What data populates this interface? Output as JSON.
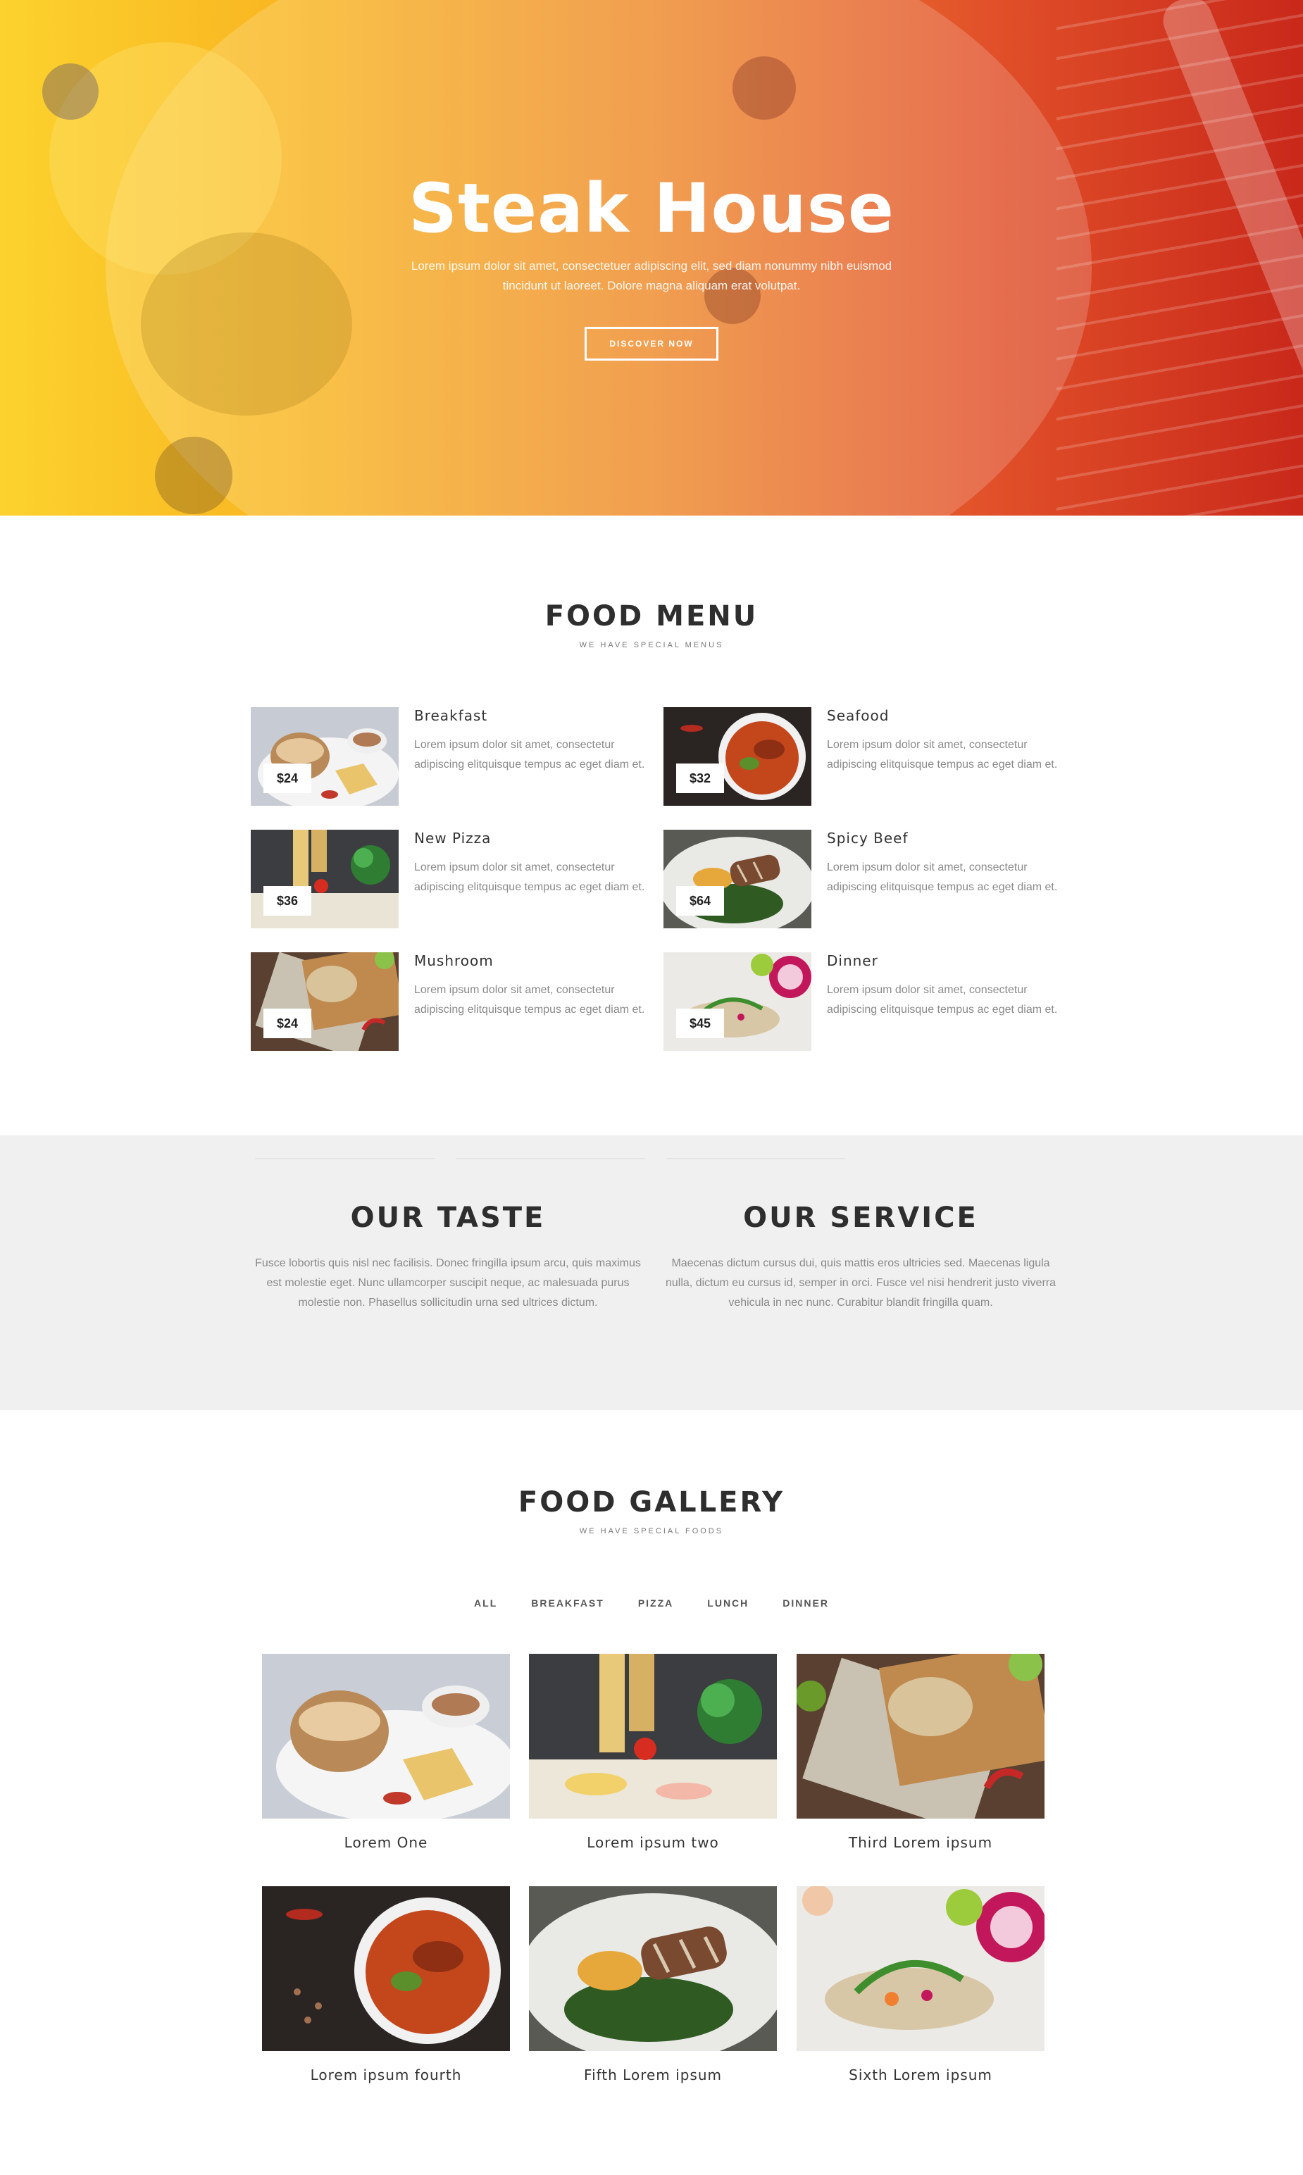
{
  "hero": {
    "title": "Steak House",
    "subtitle": "Lorem ipsum dolor sit amet, consectetuer adipiscing elit, sed diam nonummy nibh euismod tincidunt ut laoreet. Dolore magna aliquam erat volutpat.",
    "button_label": "DISCOVER NOW",
    "gradient": [
      "#fcd22e",
      "#ee8a2a",
      "#c9281a"
    ]
  },
  "menu": {
    "title": "FOOD MENU",
    "subtitle": "WE HAVE SPECIAL MENUS",
    "items": [
      {
        "name": "Breakfast",
        "price": "$24",
        "desc": "Lorem ipsum dolor sit amet, consectetur adipiscing elitquisque tempus ac eget diam et."
      },
      {
        "name": "Seafood",
        "price": "$32",
        "desc": "Lorem ipsum dolor sit amet, consectetur adipiscing elitquisque tempus ac eget diam et."
      },
      {
        "name": "New Pizza",
        "price": "$36",
        "desc": "Lorem ipsum dolor sit amet, consectetur adipiscing elitquisque tempus ac eget diam et."
      },
      {
        "name": "Spicy Beef",
        "price": "$64",
        "desc": "Lorem ipsum dolor sit amet, consectetur adipiscing elitquisque tempus ac eget diam et."
      },
      {
        "name": "Mushroom",
        "price": "$24",
        "desc": "Lorem ipsum dolor sit amet, consectetur adipiscing elitquisque tempus ac eget diam et."
      },
      {
        "name": "Dinner",
        "price": "$45",
        "desc": "Lorem ipsum dolor sit amet, consectetur adipiscing elitquisque tempus ac eget diam et."
      }
    ]
  },
  "about": {
    "taste_title": "OUR TASTE",
    "taste_text": "Fusce lobortis quis nisl nec facilisis. Donec fringilla ipsum arcu, quis maximus est molestie eget. Nunc ullamcorper suscipit neque, ac malesuada purus molestie non. Phasellus sollicitudin urna sed ultrices dictum.",
    "service_title": "OUR SERVICE",
    "service_text": "Maecenas dictum cursus dui, quis mattis eros ultricies sed. Maecenas ligula nulla, dictum eu cursus id, semper in orci. Fusce vel nisi hendrerit justo viverra vehicula in nec nunc. Curabitur blandit fringilla quam."
  },
  "gallery": {
    "title": "FOOD GALLERY",
    "subtitle": "WE HAVE SPECIAL FOODS",
    "filters": [
      "ALL",
      "BREAKFAST",
      "PIZZA",
      "LUNCH",
      "DINNER"
    ],
    "items": [
      {
        "caption": "Lorem One"
      },
      {
        "caption": "Lorem ipsum two"
      },
      {
        "caption": "Third Lorem ipsum"
      },
      {
        "caption": "Lorem ipsum fourth"
      },
      {
        "caption": "Fifth Lorem ipsum"
      },
      {
        "caption": "Sixth Lorem ipsum"
      }
    ]
  }
}
